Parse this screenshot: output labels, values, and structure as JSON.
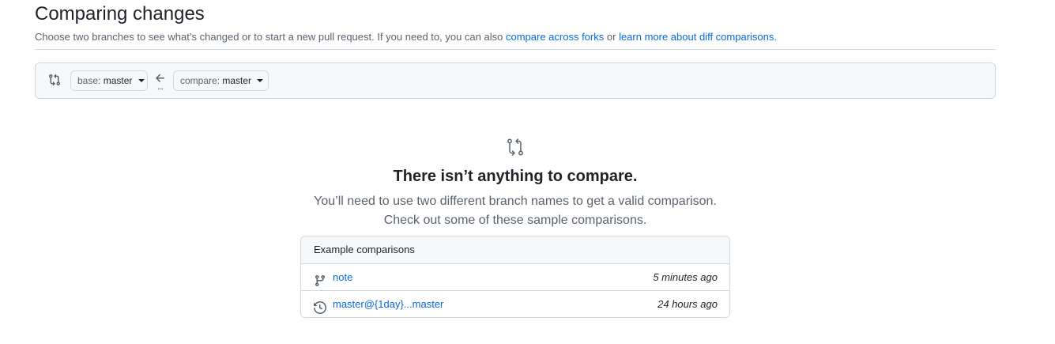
{
  "header": {
    "title": "Comparing changes",
    "subtitle_text": "Choose two branches to see what’s changed or to start a new pull request. If you need to, you can also",
    "compare_forks_link": "compare across forks",
    "or_text": "or",
    "learn_more_link": "learn more about diff comparisons",
    "period": "."
  },
  "range": {
    "icon": "git-compare-icon",
    "base_label": "base:",
    "base_branch": "master",
    "arrow_icon": "arrow-left-icon",
    "dots": "...",
    "compare_label": "compare:",
    "compare_branch": "master"
  },
  "blankslate": {
    "icon": "git-compare-icon",
    "title": "There isn’t anything to compare.",
    "line1": "You’ll need to use two different branch names to get a valid comparison.",
    "line2": "Check out some of these sample comparisons."
  },
  "examples": {
    "header": "Example comparisons",
    "rows": [
      {
        "icon": "git-branch-icon",
        "label": "note",
        "time": "5 minutes ago"
      },
      {
        "icon": "history-icon",
        "label": "master@{1day}...master",
        "time": "24 hours ago"
      }
    ]
  },
  "colors": {
    "link": "#0969da",
    "muted": "#59636e",
    "border": "#d1d9e0",
    "subtle_bg": "#f6f8fa"
  }
}
